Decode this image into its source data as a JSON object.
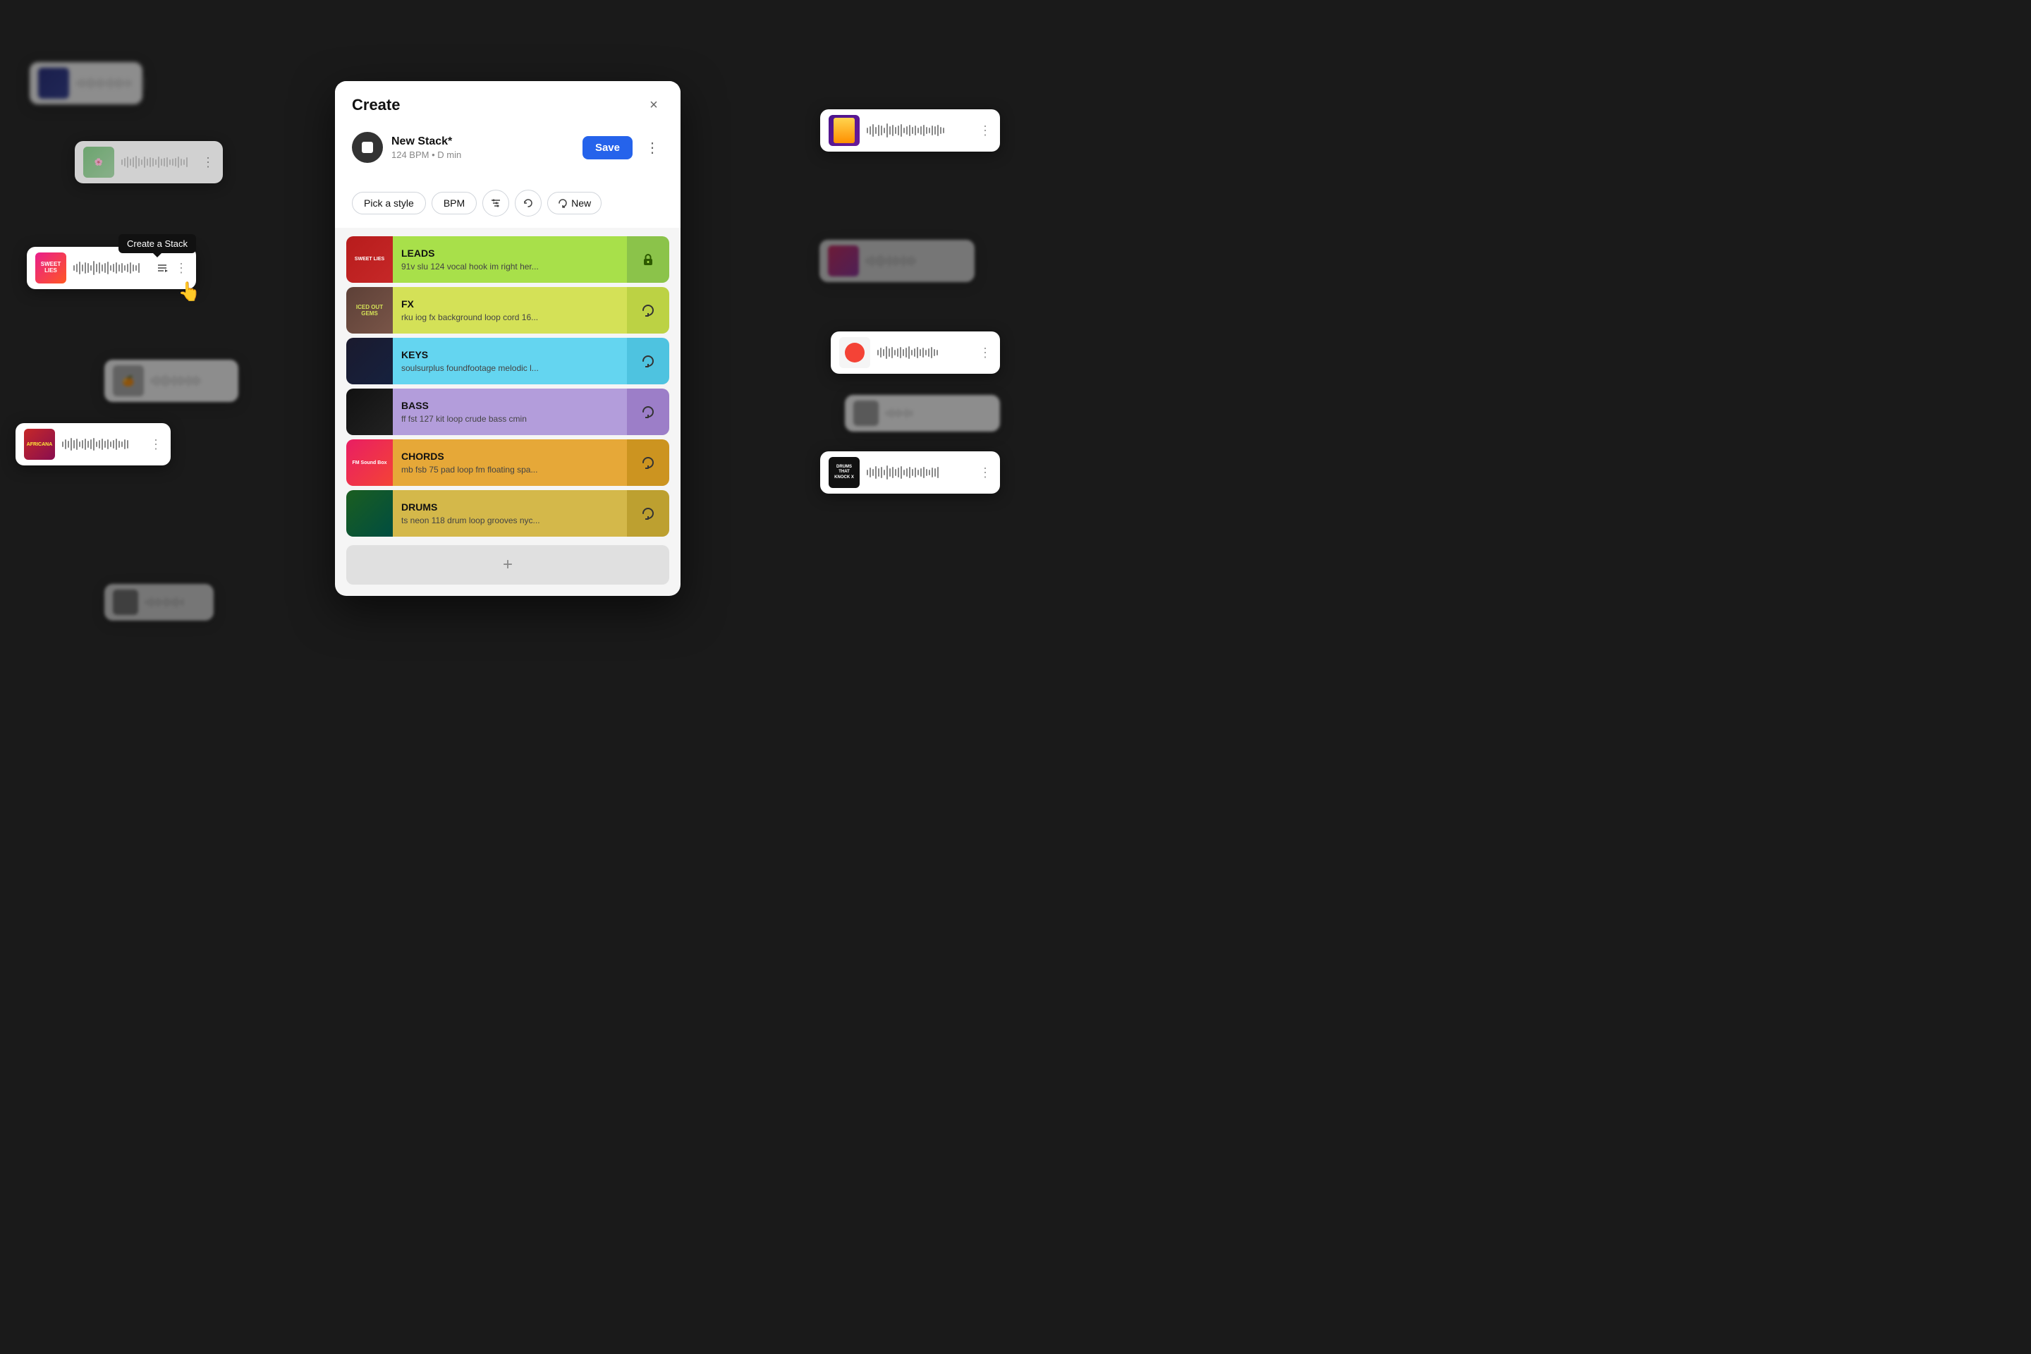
{
  "modal": {
    "title": "Create",
    "close_label": "×",
    "stack": {
      "name": "New Stack*",
      "meta": "124 BPM • D min",
      "save_label": "Save",
      "more_label": "⋮"
    },
    "toolbar": {
      "style_label": "Pick a style",
      "bpm_label": "BPM",
      "filter_icon": "⚙",
      "undo_icon": "↩",
      "new_icon": "↻",
      "new_label": "New"
    },
    "tracks": [
      {
        "id": "leads",
        "name": "LEADS",
        "tags": "91v slu 124 vocal hook im right her...",
        "color_info": "#a8e04a",
        "color_action": "#8bc34a",
        "action_icon": "lock"
      },
      {
        "id": "fx",
        "name": "FX",
        "tags": "rku iog fx background loop cord 16...",
        "color_info": "#d4e157",
        "color_action": "#bcd244",
        "action_icon": "refresh"
      },
      {
        "id": "keys",
        "name": "KEYS",
        "tags": "soulsurplus foundfootage melodic l...",
        "color_info": "#64d5f0",
        "color_action": "#4ec3e0",
        "action_icon": "refresh"
      },
      {
        "id": "bass",
        "name": "BASS",
        "tags": "ff fst 127 kit loop crude bass cmin",
        "color_info": "#b39ddb",
        "color_action": "#9c7ec8",
        "action_icon": "refresh"
      },
      {
        "id": "chords",
        "name": "CHORDS",
        "tags": "mb fsb 75 pad loop fm floating spa...",
        "color_info": "#e6a838",
        "color_action": "#cc9420",
        "action_icon": "refresh"
      },
      {
        "id": "drums",
        "name": "DRUMS",
        "tags": "ts neon 118 drum loop grooves nyc...",
        "color_info": "#d4b84a",
        "color_action": "#bda030",
        "action_icon": "refresh"
      }
    ],
    "add_label": "+"
  },
  "tooltip": {
    "text": "Create a Stack"
  },
  "background_cards": [
    {
      "id": "card-top-left",
      "label": "blurred top left"
    },
    {
      "id": "card-sweet-lies-bg",
      "label": "sweet lies background"
    },
    {
      "id": "card-africana",
      "label": "africana"
    },
    {
      "id": "card-right-portrait",
      "label": "portrait right"
    },
    {
      "id": "card-right-red",
      "label": "red dot right"
    },
    {
      "id": "card-drums-knock",
      "label": "drums that knock"
    }
  ],
  "colors": {
    "accent_blue": "#2563eb",
    "modal_bg": "#f5f5f5",
    "page_bg": "#1a1a1a"
  }
}
